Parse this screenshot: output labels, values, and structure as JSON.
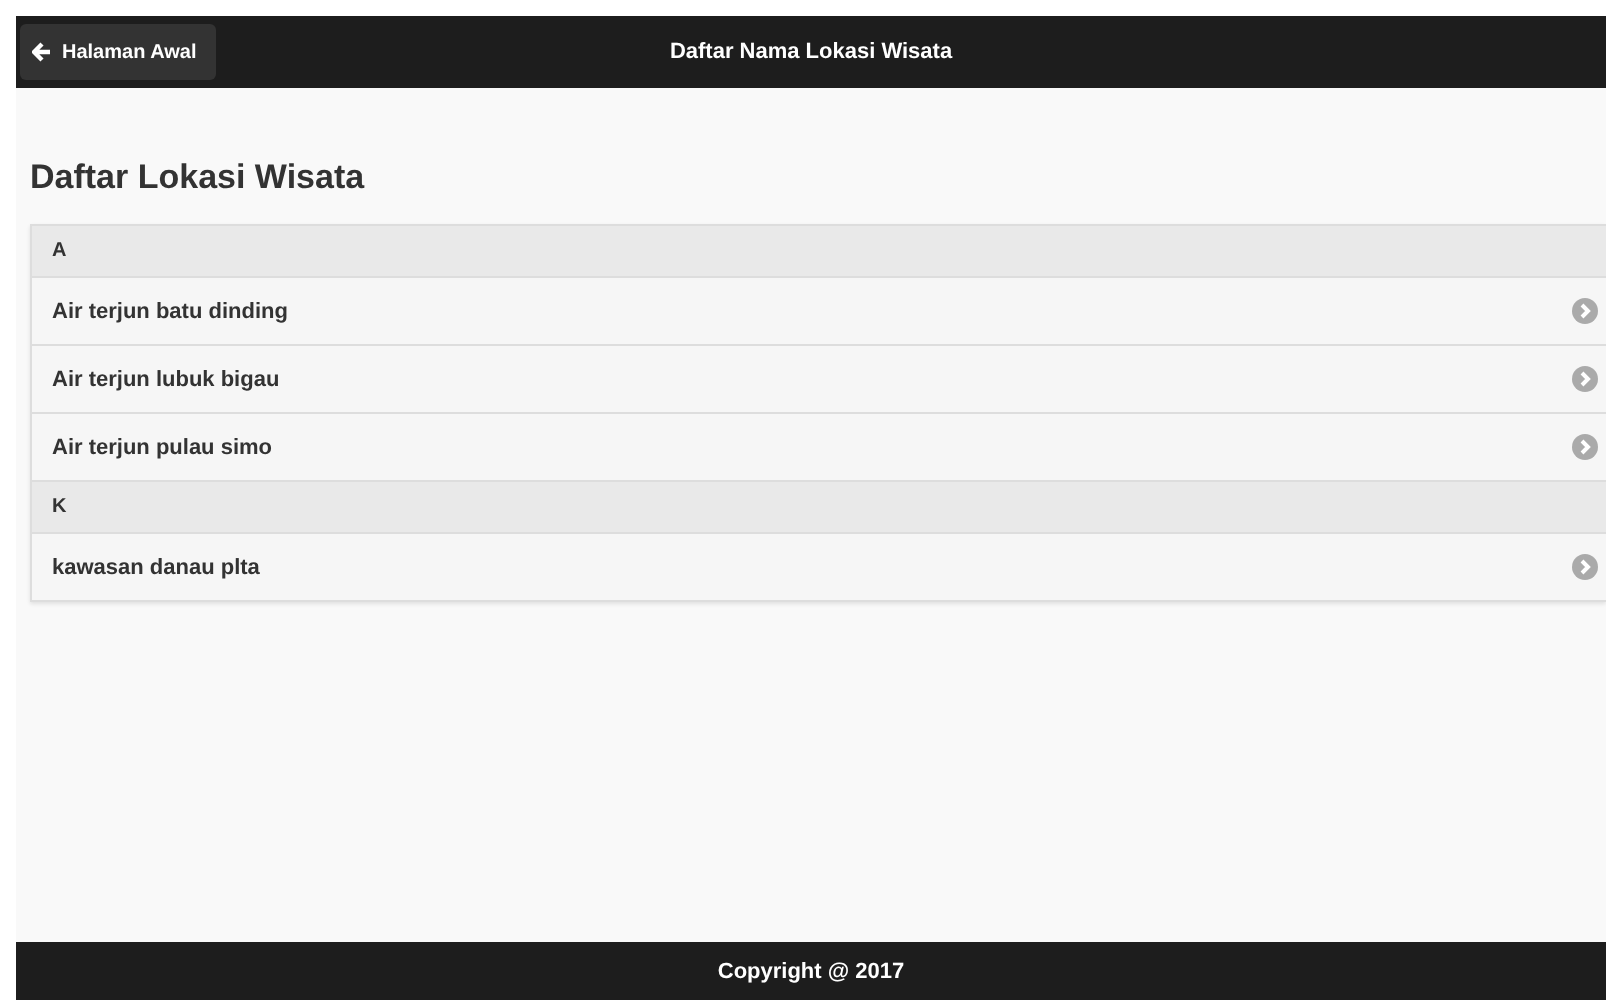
{
  "header": {
    "back_button": "Halaman Awal",
    "title": "Daftar Nama Lokasi Wisata"
  },
  "heading": "Daftar Lokasi Wisata",
  "list": [
    {
      "kind": "divider",
      "label": "A"
    },
    {
      "kind": "item",
      "label": "Air terjun batu dinding"
    },
    {
      "kind": "item",
      "label": "Air terjun lubuk bigau"
    },
    {
      "kind": "item",
      "label": "Air terjun pulau simo"
    },
    {
      "kind": "divider",
      "label": "K"
    },
    {
      "kind": "item",
      "label": "kawasan danau plta"
    }
  ],
  "footer": "Copyright @ 2017"
}
